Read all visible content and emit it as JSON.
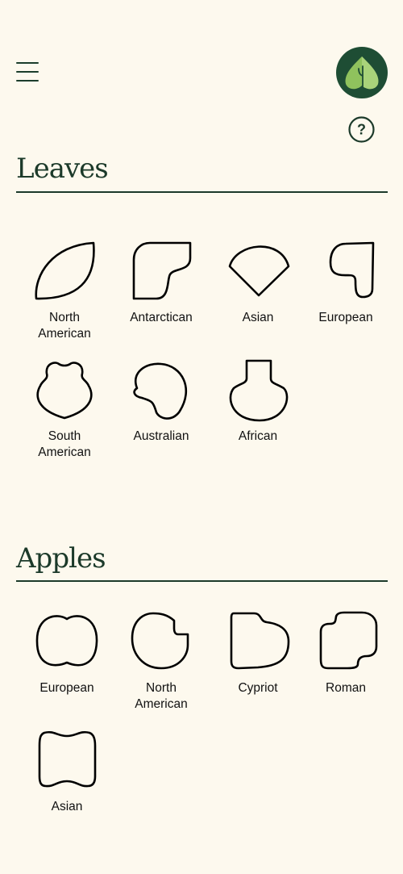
{
  "header": {
    "menu_icon": "hamburger-menu-icon",
    "logo_icon": "leaf-logo-icon",
    "help_icon": "question-mark-icon",
    "help_label": "?"
  },
  "colors": {
    "background": "#fdf9ee",
    "heading": "#1c3a2a",
    "logo_dark": "#1e4d34",
    "logo_light": "#8fc25d"
  },
  "sections": [
    {
      "title": "Leaves",
      "items": [
        {
          "label": "North\nAmerican",
          "shape": "leaf-north-american"
        },
        {
          "label": "Antarctican",
          "shape": "leaf-antarctican"
        },
        {
          "label": "Asian",
          "shape": "leaf-asian"
        },
        {
          "label": "European",
          "shape": "leaf-european"
        },
        {
          "label": "South\nAmerican",
          "shape": "leaf-south-american"
        },
        {
          "label": "Australian",
          "shape": "leaf-australian"
        },
        {
          "label": "African",
          "shape": "leaf-african"
        }
      ]
    },
    {
      "title": "Apples",
      "items": [
        {
          "label": "European",
          "shape": "apple-european"
        },
        {
          "label": "North\nAmerican",
          "shape": "apple-north-american"
        },
        {
          "label": "Cypriot",
          "shape": "apple-cypriot"
        },
        {
          "label": "Roman",
          "shape": "apple-roman"
        },
        {
          "label": "Asian",
          "shape": "apple-asian"
        }
      ]
    }
  ]
}
